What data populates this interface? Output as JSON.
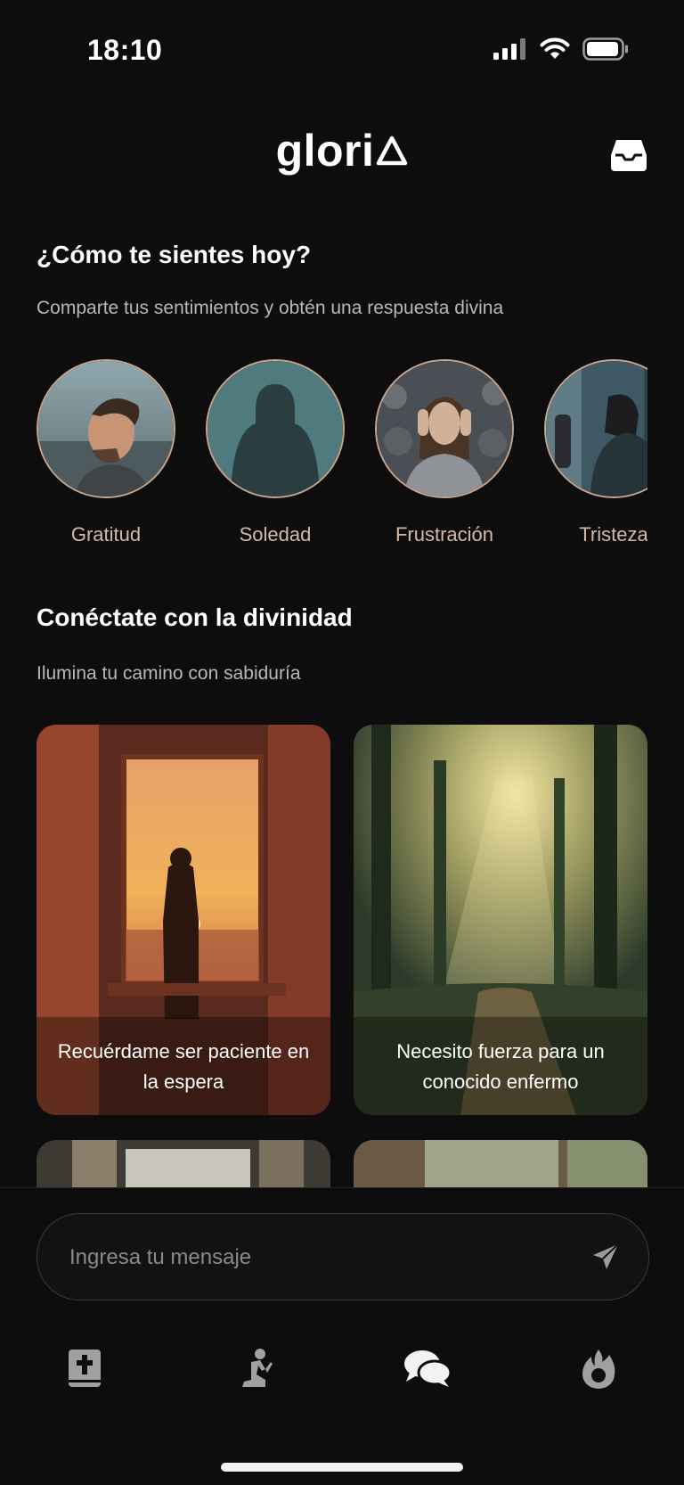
{
  "status": {
    "time": "18:10"
  },
  "app": {
    "logo_text": "glori"
  },
  "feelings": {
    "title": "¿Cómo te sientes hoy?",
    "subtitle": "Comparte tus sentimientos y obtén una respuesta divina",
    "items": [
      {
        "label": "Gratitud"
      },
      {
        "label": "Soledad"
      },
      {
        "label": "Frustración"
      },
      {
        "label": "Tristeza"
      }
    ]
  },
  "connect": {
    "title": "Conéctate con la divinidad",
    "subtitle": "Ilumina tu camino con sabiduría",
    "cards": [
      {
        "text": "Recuérdame ser paciente en la espera"
      },
      {
        "text": "Necesito fuerza para un conocido enfermo"
      }
    ]
  },
  "composer": {
    "placeholder": "Ingresa tu mensaje"
  },
  "nav": {
    "items": [
      {
        "icon": "bible-icon"
      },
      {
        "icon": "praying-icon"
      },
      {
        "icon": "chat-icon"
      },
      {
        "icon": "flame-icon"
      }
    ]
  },
  "colors": {
    "background": "#0d0d0d",
    "mood_label": "#d8b9a3",
    "mood_border": "#c8a48a"
  }
}
